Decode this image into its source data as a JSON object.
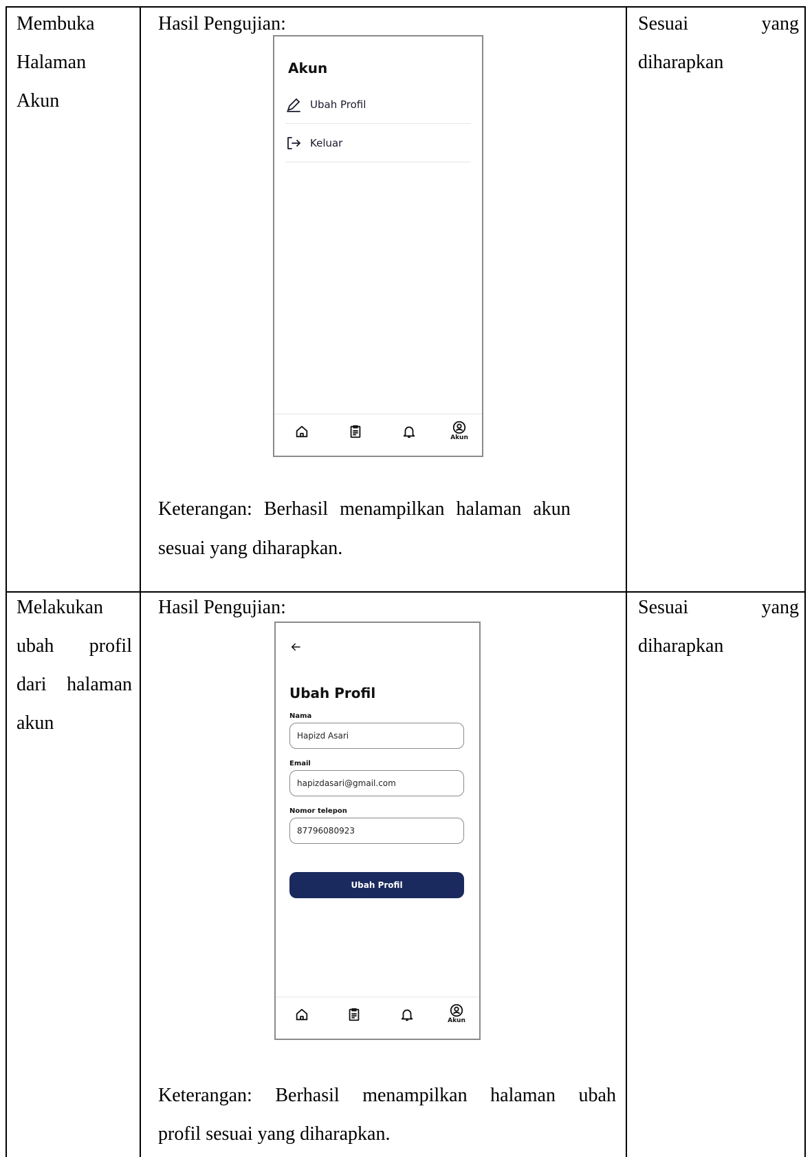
{
  "rows": [
    {
      "activity_lines": [
        "Membuka",
        "Halaman",
        "Akun"
      ],
      "result_heading": "Hasil Pengujian:",
      "status_words": [
        "Sesuai",
        "yang"
      ],
      "status_line2": "diharapkan",
      "note_line1": "Keterangan: Berhasil menampilkan halaman akun",
      "note_line2": "sesuai yang diharapkan.",
      "screen": {
        "title": "Akun",
        "menu": [
          {
            "label": "Ubah Profil",
            "icon": "pencil-icon"
          },
          {
            "label": "Keluar",
            "icon": "logout-icon"
          }
        ],
        "nav": {
          "active_label": "Akun",
          "icons": [
            "home-icon",
            "clipboard-icon",
            "bell-icon",
            "user-icon"
          ]
        }
      }
    },
    {
      "activity_lines": [
        [
          "ubah",
          "profil"
        ],
        [
          "dari",
          "halaman"
        ]
      ],
      "activity_first": "Melakukan",
      "activity_last": "akun",
      "result_heading": "Hasil Pengujian:",
      "status_words": [
        "Sesuai",
        "yang"
      ],
      "status_line2": "diharapkan",
      "note_words": [
        "Keterangan:",
        "Berhasil",
        "menampilkan",
        "halaman",
        "ubah"
      ],
      "note_line2": "profil sesuai yang diharapkan.",
      "screen": {
        "back_icon": "arrow-left-icon",
        "title": "Ubah Profil",
        "fields": [
          {
            "label": "Nama",
            "value": "Hapizd Asari"
          },
          {
            "label": "Email",
            "value": "hapizdasari@gmail.com"
          },
          {
            "label": "Nomor telepon",
            "value": "87796080923"
          }
        ],
        "submit_label": "Ubah Profil",
        "nav": {
          "active_label": "Akun",
          "icons": [
            "home-icon",
            "clipboard-icon",
            "bell-icon",
            "user-icon"
          ]
        }
      }
    }
  ]
}
